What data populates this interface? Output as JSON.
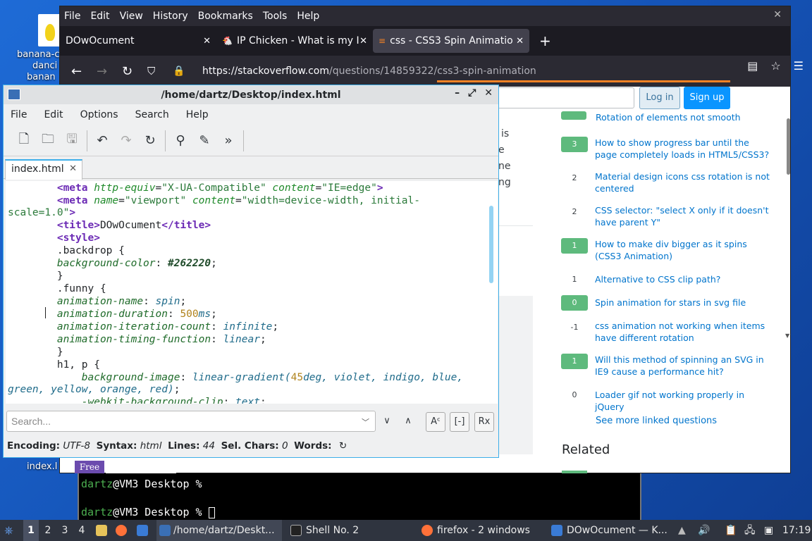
{
  "desktop": {
    "icon_label_lines": [
      "banana-c",
      "danci",
      "banan"
    ],
    "index_label": "index.l",
    "free_badge": "Free"
  },
  "firefox": {
    "menu": [
      "File",
      "Edit",
      "View",
      "History",
      "Bookmarks",
      "Tools",
      "Help"
    ],
    "tabs": [
      {
        "label": "DOwOcument",
        "active": false
      },
      {
        "label": "IP Chicken - What is my I",
        "active": false
      },
      {
        "label": "css - CSS3 Spin Animatio",
        "active": true
      }
    ],
    "url_host": "https://stackoverflow.com",
    "url_path": "/questions/14859322/css3-spin-animation",
    "login": "Log in",
    "signup": "Sign up",
    "fragments": [
      "is",
      "e",
      "ne",
      "ng"
    ],
    "partial_title": "Rotation of elements not smooth",
    "linked_questions": [
      {
        "score": "3",
        "title": "How to show progress bar until the page completely loads in HTML5/CSS3?"
      },
      {
        "score": "2",
        "title": "Material design icons css rotation is not centered"
      },
      {
        "score": "2",
        "title": "CSS selector: \"select X only if it doesn't have parent Y\""
      },
      {
        "score": "1",
        "title": "How to make div bigger as it spins (CSS3 Animation)"
      },
      {
        "score": "1",
        "title": "Alternative to CSS clip path?"
      },
      {
        "score": "0",
        "title": "Spin animation for stars in svg file"
      },
      {
        "score": "-1",
        "title": "css animation not working when items have different rotation"
      },
      {
        "score": "1",
        "title": "Will this method of spinning an SVG in IE9 cause a performance hit?"
      },
      {
        "score": "0",
        "title": "Loader gif not working properly in jQuery"
      }
    ],
    "see_more": "See more linked questions",
    "related": "Related"
  },
  "editor": {
    "title": "/home/dartz/Desktop/index.html",
    "menu": [
      "File",
      "Edit",
      "Options",
      "Search",
      "Help"
    ],
    "tab": "index.html",
    "search_placeholder": "Search...",
    "case_btn": "Aᶜ",
    "whole_btn": "[-]",
    "regex_btn": "Rx",
    "status": {
      "encoding_label": "Encoding:",
      "encoding": "UTF-8",
      "syntax_label": "Syntax:",
      "syntax": "html",
      "lines_label": "Lines:",
      "lines": "44",
      "sel_label": "Sel. Chars:",
      "sel": "0",
      "words_label": "Words:"
    }
  },
  "terminal": {
    "user": "dartz",
    "prompt_rest": "@VM3 Desktop %"
  },
  "taskbar": {
    "workspaces": [
      "1",
      "2",
      "3",
      "4"
    ],
    "editor_task": "/home/dartz/Deskt...",
    "shell_task": "Shell No. 2",
    "firefox_task": "firefox - 2 windows",
    "doc_task": "DOwOcument — K...",
    "clock": "17:19"
  }
}
